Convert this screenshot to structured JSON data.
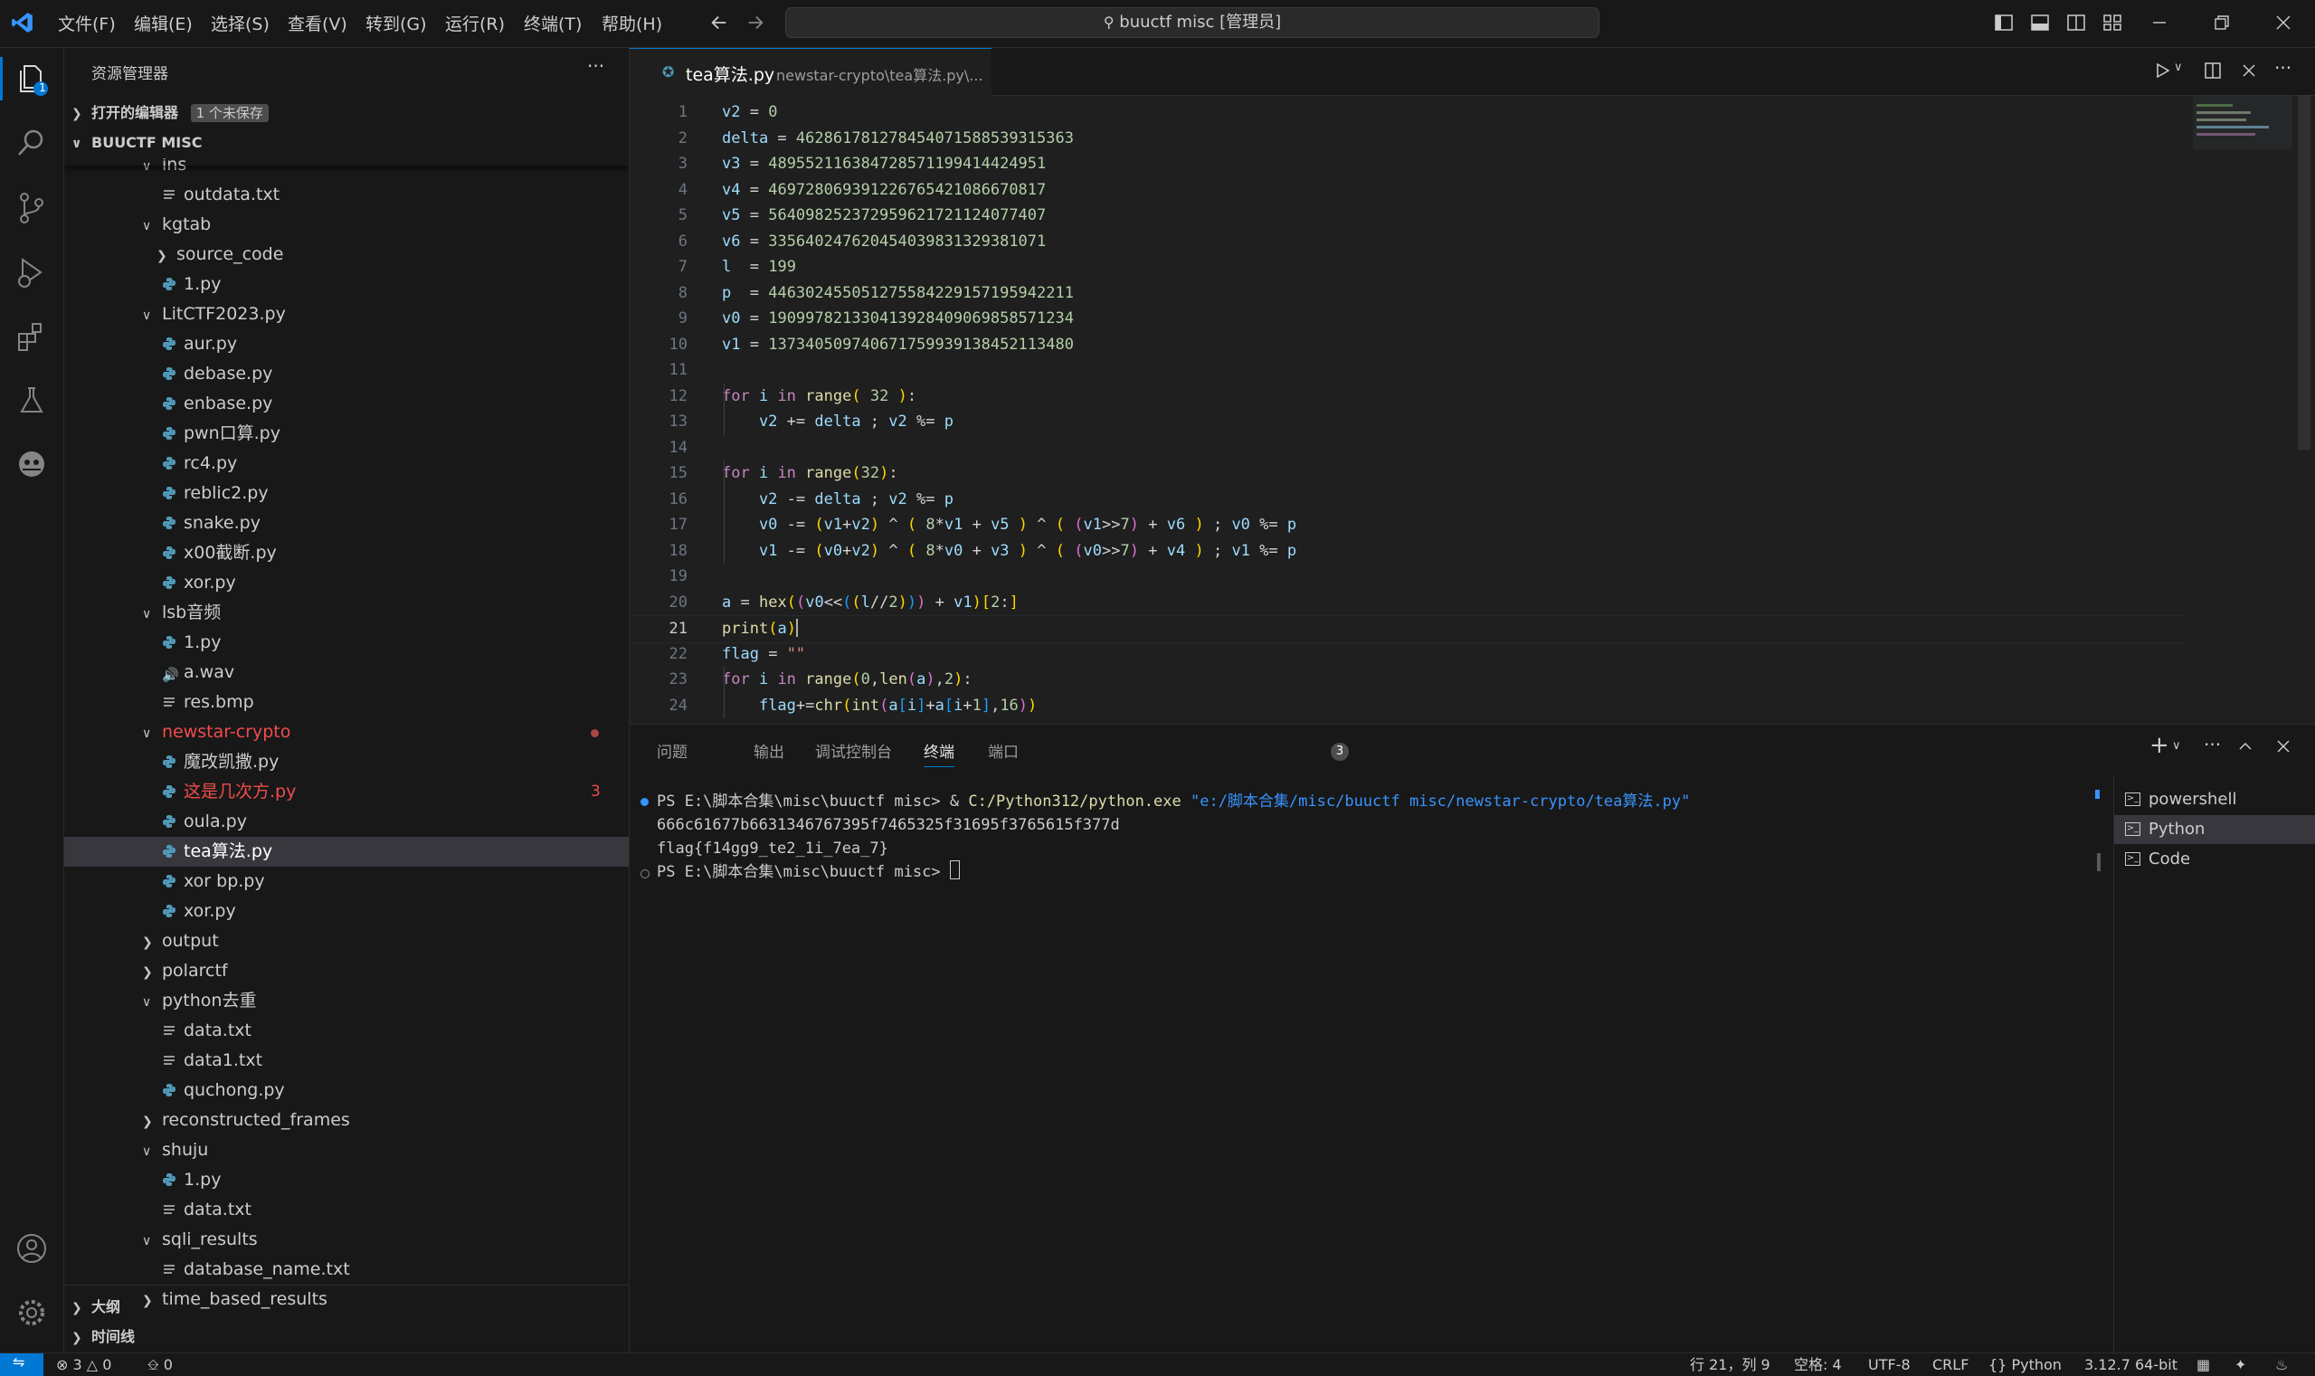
{
  "menu": [
    "文件(F)",
    "编辑(E)",
    "选择(S)",
    "查看(V)",
    "转到(G)",
    "运行(R)",
    "终端(T)",
    "帮助(H)"
  ],
  "search": {
    "text": "buuctf misc [管理员]"
  },
  "activity": {
    "explorer_badge": "1"
  },
  "sidebar": {
    "title": "资源管理器",
    "open_editors": "打开的编辑器",
    "unsaved_badge": "1 个未保存",
    "workspace": "BUUCTF MISC",
    "outline": "大纲",
    "timeline": "时间线"
  },
  "tree": [
    {
      "label": "ins",
      "kind": "folder-open",
      "depth": 0
    },
    {
      "label": "outdata.txt",
      "kind": "txt",
      "depth": 1
    },
    {
      "label": "kgtab",
      "kind": "folder-open",
      "depth": 0
    },
    {
      "label": "source_code",
      "kind": "folder",
      "depth": 1
    },
    {
      "label": "1.py",
      "kind": "py",
      "depth": 1
    },
    {
      "label": "LitCTF2023.py",
      "kind": "folder-open",
      "depth": 0
    },
    {
      "label": "aur.py",
      "kind": "py",
      "depth": 1
    },
    {
      "label": "debase.py",
      "kind": "py",
      "depth": 1
    },
    {
      "label": "enbase.py",
      "kind": "py",
      "depth": 1
    },
    {
      "label": "pwn口算.py",
      "kind": "py",
      "depth": 1
    },
    {
      "label": "rc4.py",
      "kind": "py",
      "depth": 1
    },
    {
      "label": "reblic2.py",
      "kind": "py",
      "depth": 1
    },
    {
      "label": "snake.py",
      "kind": "py",
      "depth": 1
    },
    {
      "label": "x00截断.py",
      "kind": "py",
      "depth": 1
    },
    {
      "label": "xor.py",
      "kind": "py",
      "depth": 1
    },
    {
      "label": "lsb音频",
      "kind": "folder-open",
      "depth": 0
    },
    {
      "label": "1.py",
      "kind": "py",
      "depth": 1
    },
    {
      "label": "a.wav",
      "kind": "wav",
      "depth": 1
    },
    {
      "label": "res.bmp",
      "kind": "txt",
      "depth": 1
    },
    {
      "label": "newstar-crypto",
      "kind": "folder-open",
      "depth": 0,
      "error": true,
      "dot": true
    },
    {
      "label": "魔改凯撒.py",
      "kind": "py",
      "depth": 1
    },
    {
      "label": "这是几次方.py",
      "kind": "py",
      "depth": 1,
      "error": true,
      "count": "3"
    },
    {
      "label": "oula.py",
      "kind": "py",
      "depth": 1
    },
    {
      "label": "tea算法.py",
      "kind": "py",
      "depth": 1,
      "selected": true
    },
    {
      "label": "xor bp.py",
      "kind": "py",
      "depth": 1
    },
    {
      "label": "xor.py",
      "kind": "py",
      "depth": 1
    },
    {
      "label": "output",
      "kind": "folder",
      "depth": 0
    },
    {
      "label": "polarctf",
      "kind": "folder",
      "depth": 0
    },
    {
      "label": "python去重",
      "kind": "folder-open",
      "depth": 0
    },
    {
      "label": "data.txt",
      "kind": "txt",
      "depth": 1
    },
    {
      "label": "data1.txt",
      "kind": "txt",
      "depth": 1
    },
    {
      "label": "quchong.py",
      "kind": "py",
      "depth": 1
    },
    {
      "label": "reconstructed_frames",
      "kind": "folder",
      "depth": 0
    },
    {
      "label": "shuju",
      "kind": "folder-open",
      "depth": 0
    },
    {
      "label": "1.py",
      "kind": "py",
      "depth": 1
    },
    {
      "label": "data.txt",
      "kind": "txt",
      "depth": 1
    },
    {
      "label": "sqli_results",
      "kind": "folder-open",
      "depth": 0
    },
    {
      "label": "database_name.txt",
      "kind": "txt",
      "depth": 1
    },
    {
      "label": "time_based_results",
      "kind": "folder",
      "depth": 0
    }
  ],
  "editor": {
    "tab_name": "tea算法.py",
    "tab_path": "newstar-crypto\\tea算法.py\\...",
    "current_line": 21,
    "lines": [
      {
        "n": "1",
        "html": "v2 <span class='op'>=</span> <span class='num'>0</span>"
      },
      {
        "n": "2",
        "html": "delta <span class='op'>=</span> <span class='num'>462861781278454071588539315363</span>"
      },
      {
        "n": "3",
        "html": "v3 <span class='op'>=</span> <span class='num'>489552116384728571199414424951</span>"
      },
      {
        "n": "4",
        "html": "v4 <span class='op'>=</span> <span class='num'>469728069391226765421086670817</span>"
      },
      {
        "n": "5",
        "html": "v5 <span class='op'>=</span> <span class='num'>564098252372959621721124077407</span>"
      },
      {
        "n": "6",
        "html": "v6 <span class='op'>=</span> <span class='num'>335640247620454039831329381071</span>"
      },
      {
        "n": "7",
        "html": "l  <span class='op'>=</span> <span class='num'>199</span>"
      },
      {
        "n": "8",
        "html": "p  <span class='op'>=</span> <span class='num'>446302455051275584229157195942211</span>"
      },
      {
        "n": "9",
        "html": "v0 <span class='op'>=</span> <span class='num'>190997821330413928409069858571234</span>"
      },
      {
        "n": "10",
        "html": "v1 <span class='op'>=</span> <span class='num'>137340509740671759939138452113480</span>"
      },
      {
        "n": "11",
        "html": ""
      },
      {
        "n": "12",
        "html": "<span class='kw'>for</span> i <span class='kw'>in</span> <span class='fn'>range</span><span class='p1'>(</span> <span class='num'>32</span> <span class='p1'>)</span><span class='op'>:</span>"
      },
      {
        "n": "13",
        "html": "    v2 <span class='op'>+=</span> delta <span class='op'>;</span> v2 <span class='op'>%=</span> p"
      },
      {
        "n": "14",
        "html": ""
      },
      {
        "n": "15",
        "html": "<span class='kw'>for</span> i <span class='kw'>in</span> <span class='fn'>range</span><span class='p1'>(</span><span class='num'>32</span><span class='p1'>)</span><span class='op'>:</span>"
      },
      {
        "n": "16",
        "html": "    v2 <span class='op'>-=</span> delta <span class='op'>;</span> v2 <span class='op'>%=</span> p"
      },
      {
        "n": "17",
        "html": "    v0 <span class='op'>-=</span> <span class='p1'>(</span>v1<span class='op'>+</span>v2<span class='p1'>)</span> <span class='op'>^</span> <span class='p1'>(</span> <span class='num'>8</span><span class='op'>*</span>v1 <span class='op'>+</span> v5 <span class='p1'>)</span> <span class='op'>^</span> <span class='p1'>(</span> <span class='p2'>(</span>v1<span class='op'>&gt;&gt;</span><span class='num'>7</span><span class='p2'>)</span> <span class='op'>+</span> v6 <span class='p1'>)</span> <span class='op'>;</span> v0 <span class='op'>%=</span> p"
      },
      {
        "n": "18",
        "html": "    v1 <span class='op'>-=</span> <span class='p1'>(</span>v0<span class='op'>+</span>v2<span class='p1'>)</span> <span class='op'>^</span> <span class='p1'>(</span> <span class='num'>8</span><span class='op'>*</span>v0 <span class='op'>+</span> v3 <span class='p1'>)</span> <span class='op'>^</span> <span class='p1'>(</span> <span class='p2'>(</span>v0<span class='op'>&gt;&gt;</span><span class='num'>7</span><span class='p2'>)</span> <span class='op'>+</span> v4 <span class='p1'>)</span> <span class='op'>;</span> v1 <span class='op'>%=</span> p"
      },
      {
        "n": "19",
        "html": ""
      },
      {
        "n": "20",
        "html": "a <span class='op'>=</span> <span class='fn'>hex</span><span class='p1'>(</span><span class='p2'>(</span>v0<span class='op'>&lt;&lt;</span><span class='p3'>(</span><span class='p1'>(</span>l<span class='op'>//</span><span class='num'>2</span><span class='p1'>)</span><span class='p3'>)</span><span class='p2'>)</span> <span class='op'>+</span> v1<span class='p1'>)</span><span class='p1'>[</span><span class='num'>2</span><span class='op'>:</span><span class='p1'>]</span>"
      },
      {
        "n": "21",
        "html": "<span class='fn'>print</span><span class='p1'>(</span>a<span class='p1'>)</span>"
      },
      {
        "n": "22",
        "html": "flag <span class='op'>=</span> <span class='str'>\"\"</span>"
      },
      {
        "n": "23",
        "html": "<span class='kw'>for</span> i <span class='kw'>in</span> <span class='fn'>range</span><span class='p1'>(</span><span class='num'>0</span><span class='op'>,</span><span class='fn'>len</span><span class='p2'>(</span>a<span class='p2'>)</span><span class='op'>,</span><span class='num'>2</span><span class='p1'>)</span><span class='op'>:</span>"
      },
      {
        "n": "24",
        "html": "    flag<span class='op'>+=</span><span class='fn'>chr</span><span class='p1'>(</span><span class='fn'>int</span><span class='p2'>(</span>a<span class='p3'>[</span>i<span class='p3'>]</span><span class='op'>+</span>a<span class='p3'>[</span>i<span class='op'>+</span><span class='num'>1</span><span class='p3'>]</span><span class='op'>,</span><span class='num'>16</span><span class='p2'>)</span><span class='p1'>)</span>"
      }
    ]
  },
  "panel": {
    "tabs": [
      "问题",
      "输出",
      "调试控制台",
      "终端",
      "端口"
    ],
    "problems_count": "3",
    "terminal": {
      "prompt1": "PS E:\\脚本合集\\misc\\buuctf misc> & ",
      "exe": "C:/Python312/python.exe",
      "script": " \"e:/脚本合集/misc/buuctf misc/newstar-crypto/tea算法.py\"",
      "out1": "666c61677b6631346767395f7465325f31695f3765615f377d",
      "out2": "flag{f14gg9_te2_1i_7ea_7}",
      "prompt2": "PS E:\\脚本合集\\misc\\buuctf misc> "
    },
    "sessions": [
      "powershell",
      "Python",
      "Code"
    ]
  },
  "statusbar": {
    "problems": "3",
    "warnings": "0",
    "ports": "0",
    "position": "行 21，列 9",
    "spaces": "空格: 4",
    "encoding": "UTF-8",
    "eol": "CRLF",
    "language": "Python",
    "interpreter": "3.12.7 64-bit"
  },
  "colors": {
    "accent": "#0078d4",
    "error": "#f14c4c",
    "python_icon": "#519aba"
  }
}
